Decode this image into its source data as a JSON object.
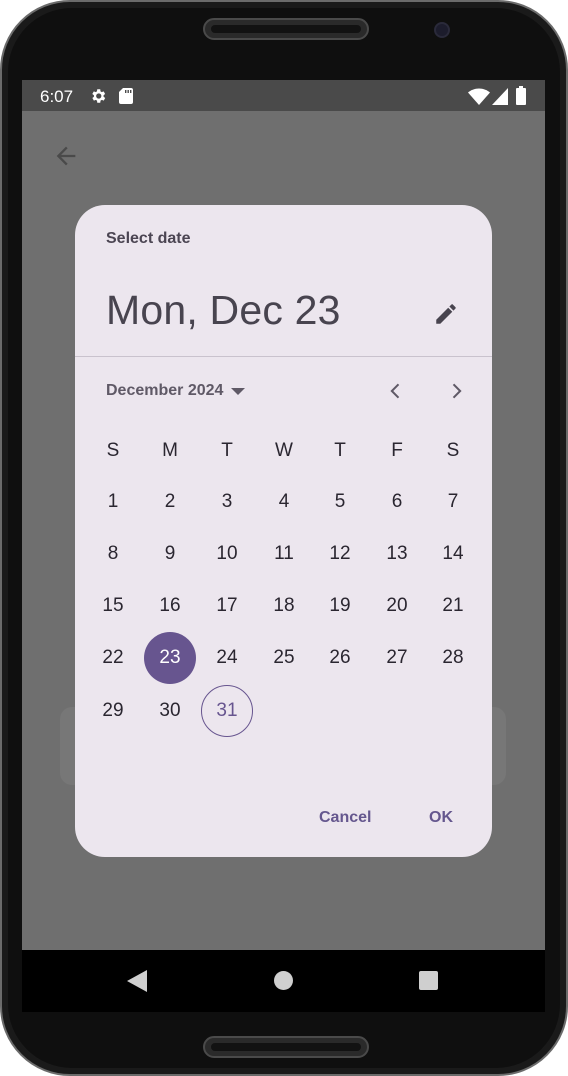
{
  "status_bar": {
    "time": "6:07",
    "icons": [
      "gear-icon",
      "sd-card-icon",
      "wifi-icon",
      "signal-icon",
      "battery-icon"
    ]
  },
  "app_bar": {
    "back_icon": "arrow-left-icon"
  },
  "date_picker": {
    "title": "Select date",
    "headline": "Mon, Dec 23",
    "edit_icon": "pencil-icon",
    "month_label": "December 2024",
    "month_dropdown_icon": "caret-down-icon",
    "prev_icon": "chevron-left-icon",
    "next_icon": "chevron-right-icon",
    "weekdays": [
      "S",
      "M",
      "T",
      "W",
      "T",
      "F",
      "S"
    ],
    "first_weekday_offset": 0,
    "days": [
      "1",
      "2",
      "3",
      "4",
      "5",
      "6",
      "7",
      "8",
      "9",
      "10",
      "11",
      "12",
      "13",
      "14",
      "15",
      "16",
      "17",
      "18",
      "19",
      "20",
      "21",
      "22",
      "23",
      "24",
      "25",
      "26",
      "27",
      "28",
      "29",
      "30",
      "31"
    ],
    "selected_day": "23",
    "today_day": "31",
    "cancel_label": "Cancel",
    "ok_label": "OK"
  },
  "colors": {
    "accent": "#67558f",
    "dialog_bg": "#ece6ee",
    "scrim": "#6f6f6f",
    "text_primary": "#2a2630"
  },
  "nav_bar": {
    "icons": [
      "nav-back-icon",
      "nav-home-icon",
      "nav-recents-icon"
    ]
  }
}
